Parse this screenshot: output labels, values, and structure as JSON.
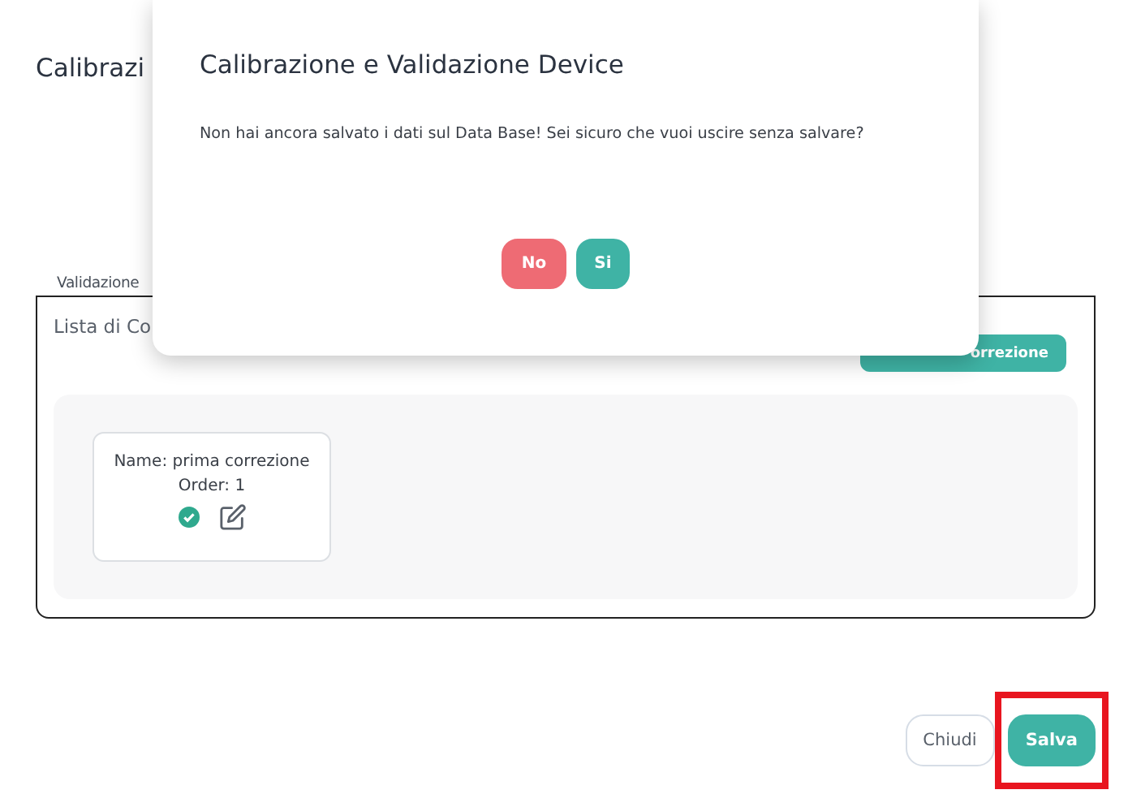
{
  "page": {
    "title": "Calibrazi",
    "section_legend": "Validazione",
    "list_title": "Lista di Co",
    "add_button": "orrezione",
    "corrections": [
      {
        "name": "Name: prima correzione",
        "order": "Order: 1",
        "validated": true
      }
    ],
    "buttons": [
      {
        "label": "Chiudi",
        "kind": "secondary",
        "highlighted": false
      },
      {
        "label": "Salva",
        "kind": "primary",
        "highlighted": true
      }
    ]
  },
  "dialog": {
    "title": "Calibrazione e Validazione Device",
    "message": "Non hai ancora salvato i dati sul Data Base! Sei sicuro che vuoi uscire senza salvare?",
    "buttons": [
      {
        "label": "No",
        "kind": "danger"
      },
      {
        "label": "Si",
        "kind": "confirm"
      }
    ]
  }
}
